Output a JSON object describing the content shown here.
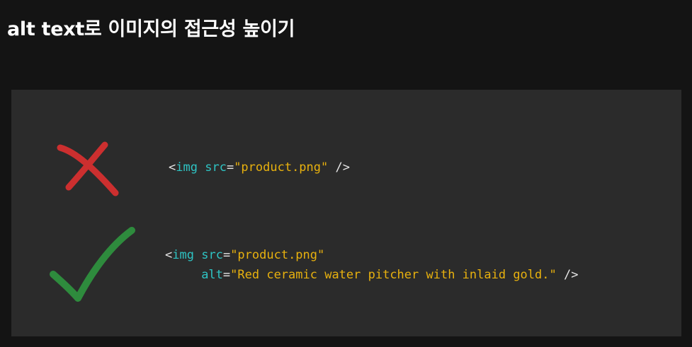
{
  "page": {
    "title": "alt text로 이미지의 접근성 높이기"
  },
  "colors": {
    "background": "#141414",
    "panel": "#2b2b2b",
    "bad_mark": "#cc2f2f",
    "good_mark": "#2e8b3d",
    "tag": "#2ec4c4",
    "string": "#e8b10e",
    "punctuation": "#e6e6e6"
  },
  "examples": {
    "bad": {
      "icon": "cross-mark-icon",
      "line1": {
        "open": "<",
        "tag": "img",
        "attr_src": "src",
        "eq": "=",
        "src_value": "\"product.png\"",
        "close": " />"
      }
    },
    "good": {
      "icon": "check-mark-icon",
      "line1": {
        "open": "<",
        "tag": "img",
        "attr_src": "src",
        "eq": "=",
        "src_value": "\"product.png\""
      },
      "line2": {
        "indent": "     ",
        "attr_alt": "alt",
        "eq": "=",
        "alt_value": "\"Red ceramic water pitcher with inlaid gold.\"",
        "close": " />"
      }
    }
  }
}
